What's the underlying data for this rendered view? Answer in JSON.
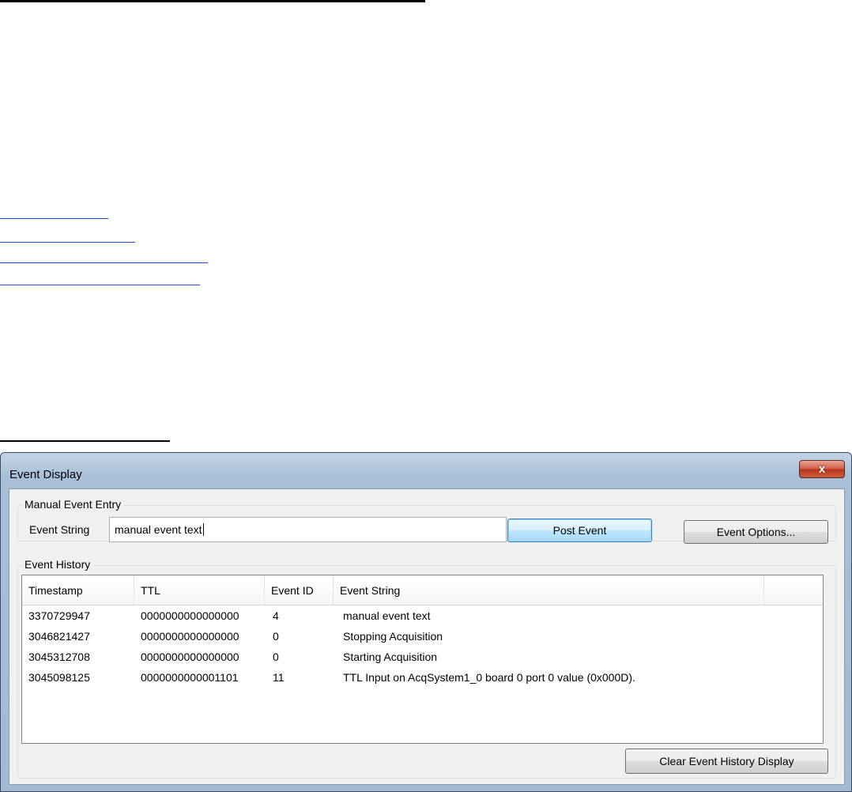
{
  "window": {
    "title": "Event Display",
    "close_symbol": "x"
  },
  "manual_entry": {
    "group_label": "Manual Event Entry",
    "event_string_label": "Event String",
    "event_string_value": "manual event text",
    "post_button": "Post Event",
    "options_button": "Event Options..."
  },
  "history": {
    "group_label": "Event History",
    "columns": [
      "Timestamp",
      "TTL",
      "Event ID",
      "Event String"
    ],
    "rows": [
      {
        "timestamp": "3370729947",
        "ttl": "0000000000000000",
        "event_id": "4",
        "event_string": "manual event text"
      },
      {
        "timestamp": "3046821427",
        "ttl": "0000000000000000",
        "event_id": "0",
        "event_string": "Stopping Acquisition"
      },
      {
        "timestamp": "3045312708",
        "ttl": "0000000000000000",
        "event_id": "0",
        "event_string": "Starting Acquisition"
      },
      {
        "timestamp": "3045098125",
        "ttl": "0000000000001101",
        "event_id": "11",
        "event_string": "TTL Input on AcqSystem1_0 board 0 port 0 value (0x000D)."
      }
    ],
    "clear_button": "Clear Event History Display"
  }
}
